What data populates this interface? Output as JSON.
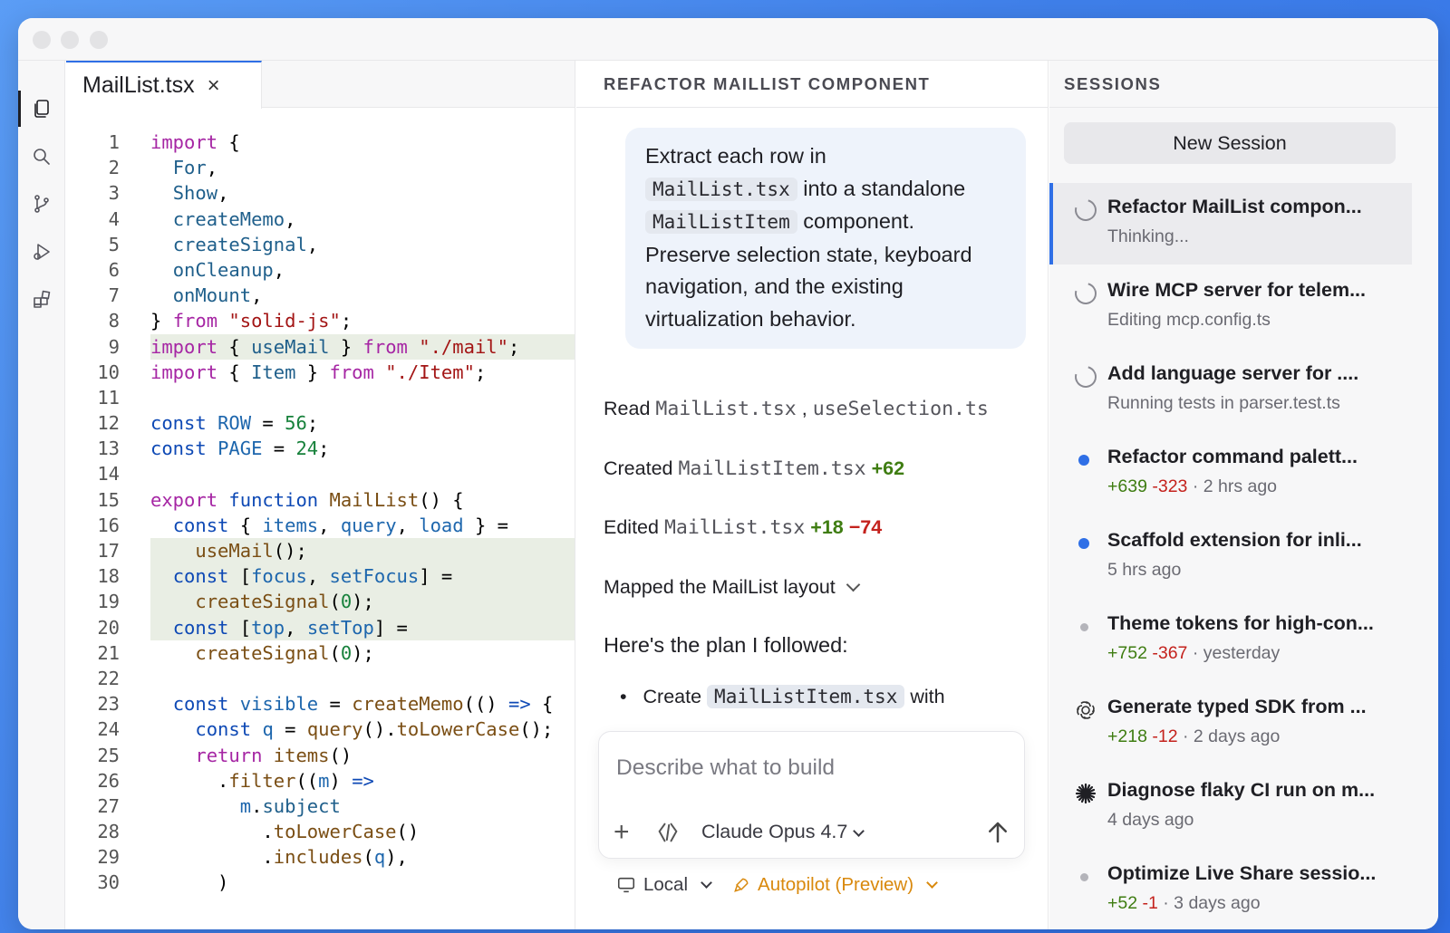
{
  "editor": {
    "tab_label": "MailList.tsx",
    "tab_close": "×"
  },
  "chat": {
    "header": "REFACTOR MAILLIST COMPONENT",
    "prompt": {
      "text1": "Extract each row in",
      "code1": "MailList.tsx",
      "text2": "into a standalone",
      "code2": "MailListItem",
      "text3": "component.",
      "text4": "Preserve selection state, keyboard navigation, and the existing virtualization behavior."
    },
    "activity": {
      "read_label": "Read",
      "read_file1": "MailList.tsx",
      "read_sep": ",",
      "read_file2": "useSelection.ts",
      "created_label": "Created",
      "created_file": "MailListItem.tsx",
      "created_plus": "+62",
      "edited_label": "Edited",
      "edited_file": "MailList.tsx",
      "edited_plus": "+18",
      "edited_minus": "−74",
      "mapped_label": "Mapped the MailList layout",
      "plan_label": "Here's the plan I followed:",
      "bullet_text1": "Create",
      "bullet_code": "MailListItem.tsx",
      "bullet_text2": "with"
    },
    "composer": {
      "placeholder": "Describe what to build",
      "model": "Claude Opus 4.7"
    },
    "footer": {
      "local": "Local",
      "autopilot": "Autopilot (Preview)"
    }
  },
  "sessions": {
    "header": "SESSIONS",
    "new_session": "New Session",
    "items": [
      {
        "title": "Refactor MailList compon...",
        "status": "Thinking...",
        "icon": "spinner-icon"
      },
      {
        "title": "Wire MCP server for telem...",
        "status": "Editing mcp.config.ts",
        "icon": "spinner-icon"
      },
      {
        "title": "Add language server for ....",
        "status": "Running tests in parser.test.ts",
        "icon": "spinner-icon"
      },
      {
        "title": "Refactor command palett...",
        "plus": "+639",
        "minus": "-323",
        "time": "· 2 hrs ago",
        "icon": "blue-dot-icon"
      },
      {
        "title": "Scaffold extension for inli...",
        "time": "5 hrs ago",
        "icon": "blue-dot-icon"
      },
      {
        "title": "Theme tokens for high-con...",
        "plus": "+752",
        "minus": "-367",
        "time": "· yesterday",
        "icon": "grey-dot-icon"
      },
      {
        "title": "Generate typed SDK from ...",
        "plus": "+218",
        "minus": "-12",
        "time": "· 2 days ago",
        "icon": "openai-icon"
      },
      {
        "title": "Diagnose flaky CI run on m...",
        "time": "4 days ago",
        "icon": "asterisk-icon"
      },
      {
        "title": "Optimize Live Share sessio...",
        "plus": "+52",
        "minus": "-1",
        "time": "· 3 days ago",
        "icon": "grey-dot-icon"
      }
    ]
  },
  "colors": {
    "accent": "#2f6fe6",
    "added": "#3f7d12",
    "removed": "#c4221d",
    "autopilot": "#d9890d"
  }
}
